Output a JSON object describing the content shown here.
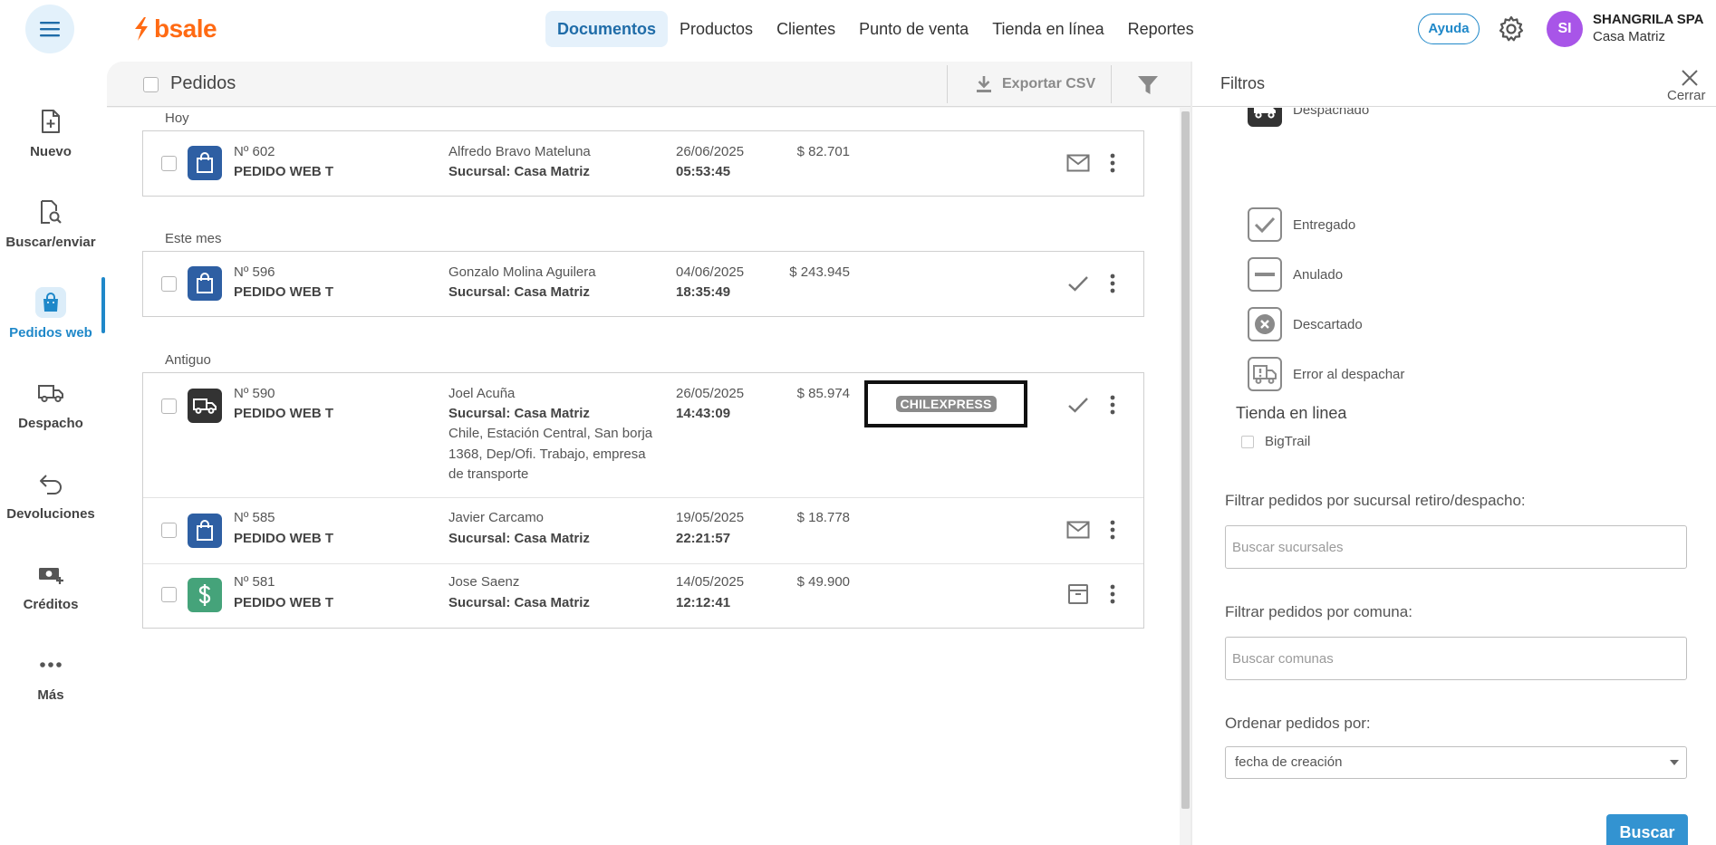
{
  "topbar": {
    "logo": "bsale",
    "nav": [
      {
        "label": "Documentos",
        "active": true
      },
      {
        "label": "Productos",
        "active": false
      },
      {
        "label": "Clientes",
        "active": false
      },
      {
        "label": "Punto de venta",
        "active": false
      },
      {
        "label": "Tienda en línea",
        "active": false
      },
      {
        "label": "Reportes",
        "active": false
      }
    ],
    "help": "Ayuda",
    "avatar": "SI",
    "company": "SHANGRILA SPA",
    "branch": "Casa Matriz"
  },
  "sidebar": {
    "items": [
      {
        "label": "Nuevo",
        "icon": "new-document-icon"
      },
      {
        "label": "Buscar/enviar",
        "icon": "search-document-icon"
      },
      {
        "label": "Pedidos web",
        "icon": "shopping-bag-icon",
        "active": true
      },
      {
        "label": "Despacho",
        "icon": "truck-icon"
      },
      {
        "label": "Devoluciones",
        "icon": "return-arrow-icon"
      },
      {
        "label": "Créditos",
        "icon": "money-plus-icon"
      },
      {
        "label": "Más",
        "icon": "more-dots-icon"
      }
    ]
  },
  "list": {
    "title": "Pedidos",
    "export": "Exportar CSV",
    "groups": [
      {
        "label": "Hoy"
      },
      {
        "label": "Este mes"
      },
      {
        "label": "Antiguo"
      }
    ],
    "orders": [
      {
        "number": "Nº 602",
        "type": "PEDIDO WEB T",
        "client": "Alfredo Bravo Mateluna",
        "branch": "Sucursal: Casa Matriz",
        "date": "26/06/2025",
        "time": "05:53:45",
        "amount": "$ 82.701",
        "icon": "shopping-bag-icon",
        "status_icon": "mail-icon"
      },
      {
        "number": "Nº 596",
        "type": "PEDIDO WEB T",
        "client": "Gonzalo Molina Aguilera",
        "branch": "Sucursal: Casa Matriz",
        "date": "04/06/2025",
        "time": "18:35:49",
        "amount": "$ 243.945",
        "icon": "shopping-bag-icon",
        "status_icon": "check-icon"
      },
      {
        "number": "Nº 590",
        "type": "PEDIDO WEB T",
        "client": "Joel Acuña",
        "branch": "Sucursal: Casa Matriz",
        "address": "Chile, Estación Central, San borja 1368, Dep/Ofi. Trabajo, empresa de transporte",
        "date": "26/05/2025",
        "time": "14:43:09",
        "amount": "$ 85.974",
        "courier": "CHILEXPRESS",
        "icon": "truck-icon",
        "status_icon": "check-icon"
      },
      {
        "number": "Nº 585",
        "type": "PEDIDO WEB T",
        "client": "Javier Carcamo",
        "branch": "Sucursal: Casa Matriz",
        "date": "19/05/2025",
        "time": "22:21:57",
        "amount": "$ 18.778",
        "icon": "shopping-bag-icon",
        "status_icon": "mail-icon"
      },
      {
        "number": "Nº 581",
        "type": "PEDIDO WEB T",
        "client": "Jose Saenz",
        "branch": "Sucursal: Casa Matriz",
        "date": "14/05/2025",
        "time": "12:12:41",
        "amount": "$ 49.900",
        "icon": "dollar-icon",
        "status_icon": "archive-box-icon"
      }
    ]
  },
  "filters": {
    "title": "Filtros",
    "close": "Cerrar",
    "statuses": [
      {
        "label": "Despachado",
        "icon": "truck-icon"
      },
      {
        "label": "Entregado",
        "icon": "check-icon"
      },
      {
        "label": "Anulado",
        "icon": "minus-icon"
      },
      {
        "label": "Descartado",
        "icon": "x-circle-icon"
      },
      {
        "label": "Error al despachar",
        "icon": "truck-error-icon"
      }
    ],
    "store_section": "Tienda en linea",
    "store_option": "BigTrail",
    "branch_label": "Filtrar pedidos por sucursal retiro/despacho:",
    "branch_placeholder": "Buscar sucursales",
    "comuna_label": "Filtrar pedidos por comuna:",
    "comuna_placeholder": "Buscar comunas",
    "order_label": "Ordenar pedidos por:",
    "order_value": "fecha de creación",
    "search": "Buscar"
  },
  "colors": {
    "accent": "#1f88c9",
    "brand": "#ff6a13",
    "bag_icon_bg": "#2e5fa3",
    "dollar_icon_bg": "#45a37a",
    "truck_icon_bg": "#333333",
    "avatar_bg": "#a855e8",
    "search_button": "#3393d1"
  }
}
